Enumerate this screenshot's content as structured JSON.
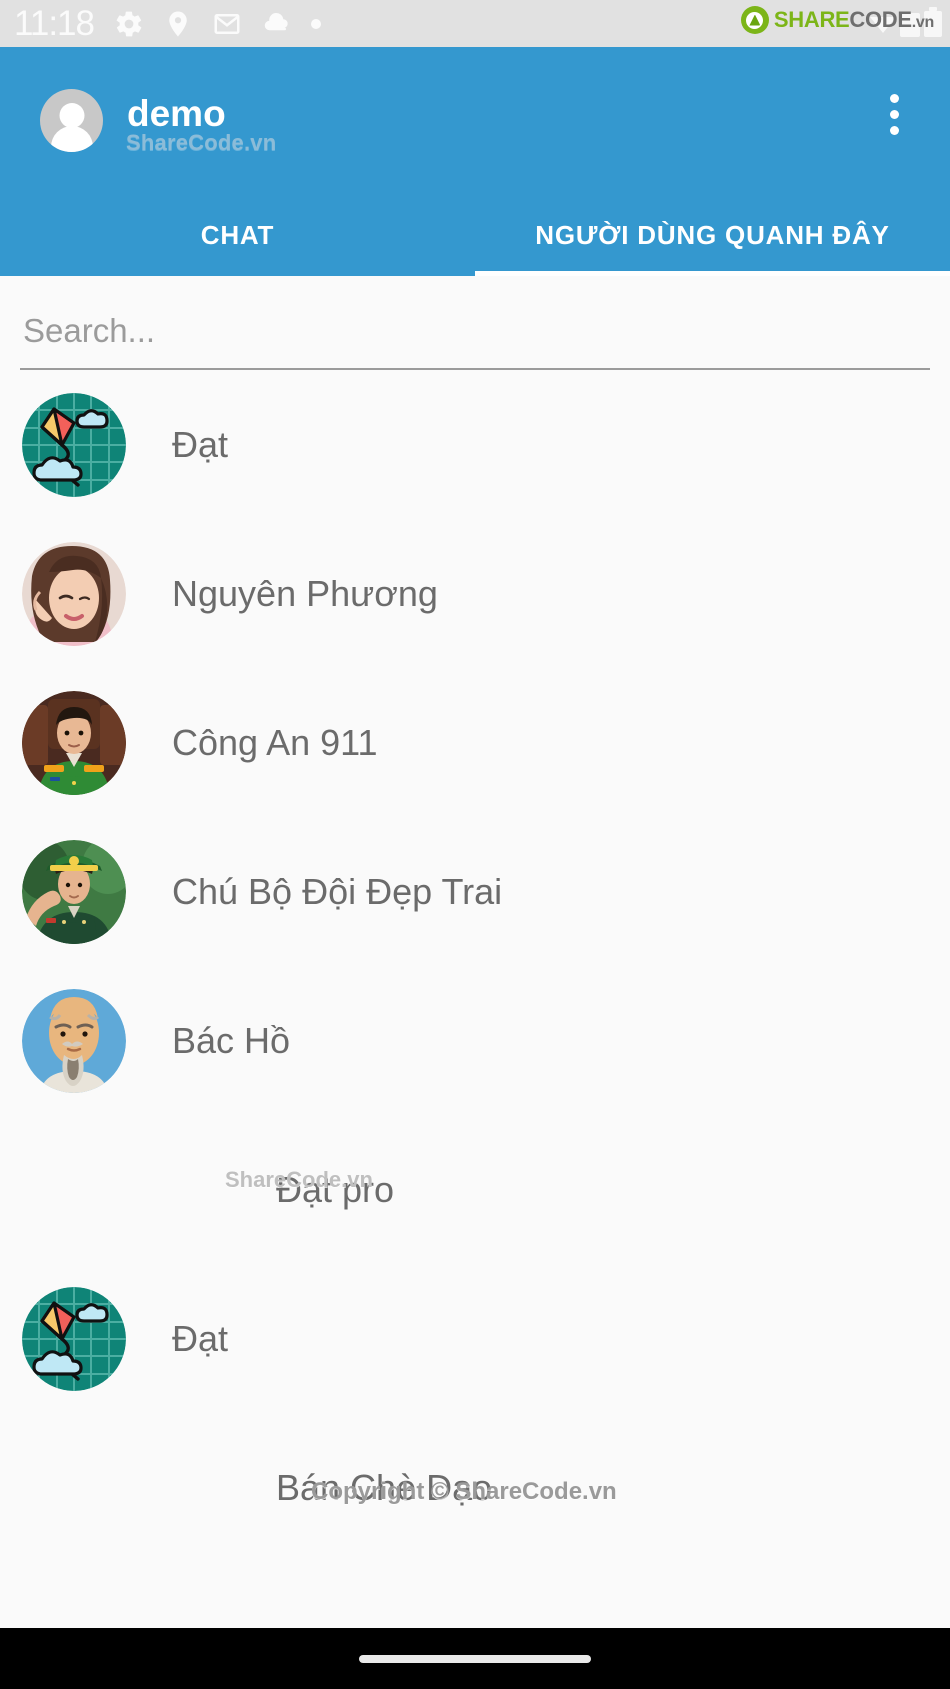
{
  "status_bar": {
    "time": "11:18",
    "icons": [
      "gear-icon",
      "location-pin-icon",
      "gmail-icon",
      "cloud-icon",
      "dot-icon"
    ],
    "watermark": {
      "brand_green": "SHARE",
      "brand_gray": "CODE",
      "suffix": ".vn"
    },
    "background_color": "#e1e1e1"
  },
  "app_bar": {
    "title": "demo",
    "watermark": "ShareCode.vn",
    "avatar": "default-person-avatar",
    "overflow_menu": "more-options",
    "background_color": "#3498cf"
  },
  "tabs": {
    "items": [
      {
        "label": "CHAT",
        "active": false
      },
      {
        "label": "NGƯỜI DÙNG QUANH ĐÂY",
        "active": true
      }
    ],
    "indicator_color": "#ffffff"
  },
  "search": {
    "placeholder": "Search...",
    "value": ""
  },
  "user_list": [
    {
      "name": "Đạt",
      "avatar": "kite-clouds-illustration"
    },
    {
      "name": "Nguyên Phương",
      "avatar": "young-woman-photo"
    },
    {
      "name": "Công An 911",
      "avatar": "police-officer-photo"
    },
    {
      "name": "Chú Bộ Đội Đẹp Trai",
      "avatar": "saluting-soldier-photo"
    },
    {
      "name": "Bác Hồ",
      "avatar": "ho-chi-minh-portrait"
    },
    {
      "name": "Đạt pro",
      "avatar": "none"
    },
    {
      "name": "Đạt",
      "avatar": "kite-clouds-illustration"
    },
    {
      "name": "Bán Chè Dạo",
      "avatar": "none"
    }
  ],
  "watermarks": {
    "middle": "ShareCode.vn",
    "bottom": "Copyright © ShareCode.vn"
  },
  "nav_bar": {
    "gesture_pill": "home-indicator"
  }
}
